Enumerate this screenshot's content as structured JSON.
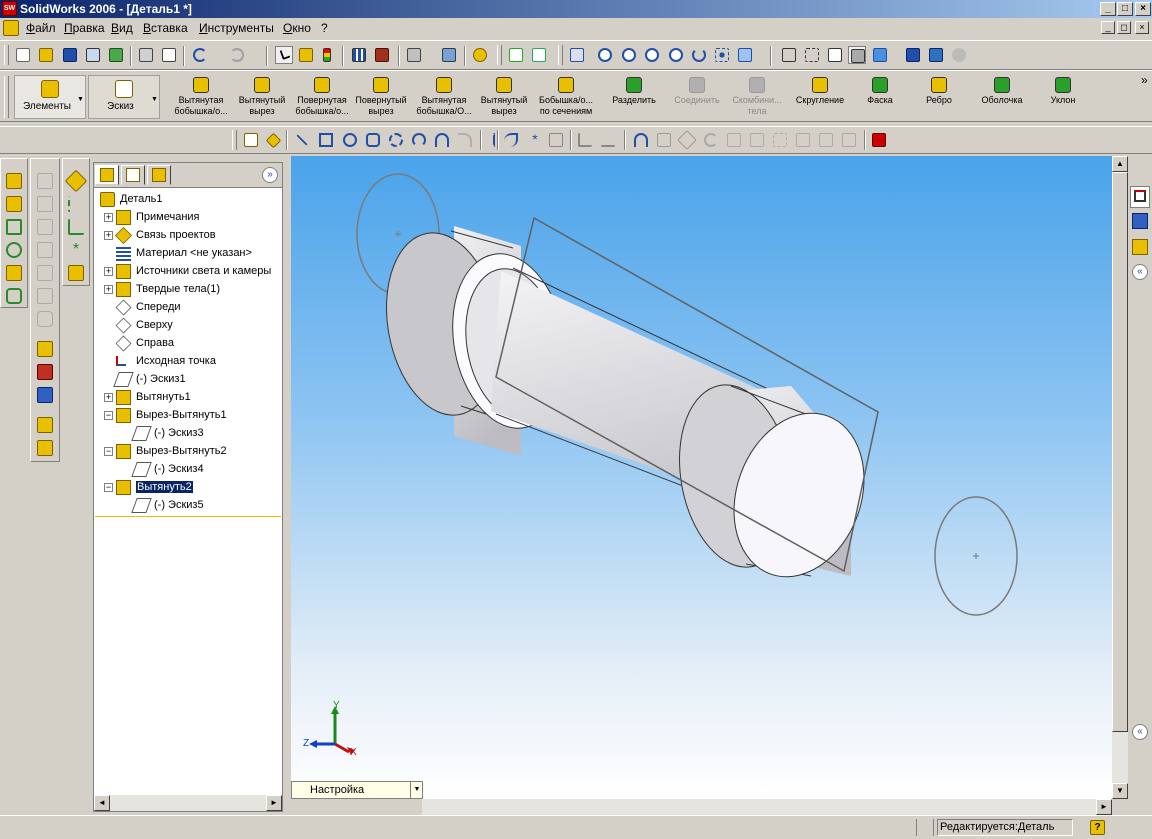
{
  "window": {
    "title": "SolidWorks 2006 - [Деталь1 *]",
    "app_icon": "SW",
    "minimize_label": "_",
    "maximize_label": "□",
    "close_label": "×"
  },
  "menu": {
    "items": [
      "Файл",
      "Правка",
      "Вид",
      "Вставка",
      "Инструменты",
      "Окно",
      "?"
    ],
    "mdi": [
      "_",
      "◻",
      "×"
    ]
  },
  "command_manager": {
    "tabs": [
      {
        "label": "Элементы",
        "icon": "features-icon"
      },
      {
        "label": "Эскиз",
        "icon": "sketch-icon"
      }
    ],
    "dropdown_arrow": "▼",
    "features": [
      {
        "label1": "Вытянутая",
        "label2": "бобышка/о...",
        "icon": "extruded-boss-icon",
        "color": "#e8c000",
        "enabled": true
      },
      {
        "label1": "Вытянутый",
        "label2": "вырез",
        "icon": "extruded-cut-icon",
        "color": "#e8c000",
        "enabled": true
      },
      {
        "label1": "Повернутая",
        "label2": "бобышка/о...",
        "icon": "revolved-boss-icon",
        "color": "#e8c000",
        "enabled": true
      },
      {
        "label1": "Повернутый",
        "label2": "вырез",
        "icon": "revolved-cut-icon",
        "color": "#e8c000",
        "enabled": true
      },
      {
        "label1": "Вытянутая",
        "label2": "бобышка/О...",
        "icon": "swept-boss-icon",
        "color": "#e8c000",
        "enabled": true
      },
      {
        "label1": "Вытянутый",
        "label2": "вырез",
        "icon": "swept-cut-icon",
        "color": "#e8c000",
        "enabled": true
      },
      {
        "label1": "Бобышка/о...",
        "label2": "по сечениям",
        "icon": "loft-icon",
        "color": "#e8c000",
        "enabled": true
      },
      {
        "label1": "Разделить",
        "label2": "",
        "icon": "split-icon",
        "color": "#2aa02a",
        "enabled": true
      },
      {
        "label1": "Соединить",
        "label2": "",
        "icon": "combine-icon",
        "color": "#b0b0b0",
        "enabled": false
      },
      {
        "label1": "Скомбини...",
        "label2": "тела",
        "icon": "combine-bodies-icon",
        "color": "#b0b0b0",
        "enabled": false
      },
      {
        "label1": "Скругление",
        "label2": "",
        "icon": "fillet-icon",
        "color": "#e8c000",
        "enabled": true
      },
      {
        "label1": "Фаска",
        "label2": "",
        "icon": "chamfer-icon",
        "color": "#2aa02a",
        "enabled": true
      },
      {
        "label1": "Ребро",
        "label2": "",
        "icon": "rib-icon",
        "color": "#e8c000",
        "enabled": true
      },
      {
        "label1": "Оболочка",
        "label2": "",
        "icon": "shell-icon",
        "color": "#2aa02a",
        "enabled": true
      },
      {
        "label1": "Уклон",
        "label2": "",
        "icon": "draft-icon",
        "color": "#2aa02a",
        "enabled": true
      }
    ],
    "overflow": "»"
  },
  "tree": {
    "tabs": [
      "feature-manager-icon",
      "property-manager-icon",
      "configuration-manager-icon"
    ],
    "collapse": "»",
    "items": [
      {
        "label": "Деталь1",
        "icon": "part-icon",
        "expander": "",
        "level": 0
      },
      {
        "label": "Примечания",
        "icon": "annotations-icon",
        "expander": "+",
        "level": 1
      },
      {
        "label": "Связь проектов",
        "icon": "design-binder-icon",
        "expander": "+",
        "level": 1
      },
      {
        "label": "Материал <не указан>",
        "icon": "material-icon",
        "expander": "",
        "level": 1
      },
      {
        "label": "Источники света и камеры",
        "icon": "lights-icon",
        "expander": "+",
        "level": 1
      },
      {
        "label": "Твердые тела(1)",
        "icon": "solid-bodies-icon",
        "expander": "+",
        "level": 1
      },
      {
        "label": "Спереди",
        "icon": "plane-icon",
        "expander": "",
        "level": 1
      },
      {
        "label": "Сверху",
        "icon": "plane-icon",
        "expander": "",
        "level": 1
      },
      {
        "label": "Справа",
        "icon": "plane-icon",
        "expander": "",
        "level": 1
      },
      {
        "label": "Исходная точка",
        "icon": "origin-icon",
        "expander": "",
        "level": 1
      },
      {
        "label": "(-) Эскиз1",
        "icon": "sketch-icon",
        "expander": "",
        "level": 1
      },
      {
        "label": "Вытянуть1",
        "icon": "extrude-icon",
        "expander": "+",
        "level": 1
      },
      {
        "label": "Вырез-Вытянуть1",
        "icon": "cut-extrude-icon",
        "expander": "−",
        "level": 1
      },
      {
        "label": "(-) Эскиз3",
        "icon": "sketch-icon",
        "expander": "",
        "level": 2
      },
      {
        "label": "Вырез-Вытянуть2",
        "icon": "cut-extrude-icon",
        "expander": "−",
        "level": 1
      },
      {
        "label": "(-) Эскиз4",
        "icon": "sketch-icon",
        "expander": "",
        "level": 2
      },
      {
        "label": "Вытянуть2",
        "icon": "extrude-icon",
        "expander": "−",
        "level": 1,
        "selected": true
      },
      {
        "label": "(-) Эскиз5",
        "icon": "sketch-icon",
        "expander": "",
        "level": 2
      }
    ]
  },
  "viewport": {
    "triad": {
      "x": "X",
      "y": "Y",
      "z": "Z"
    },
    "settings_label": "Настройка",
    "settings_arrow": "▼"
  },
  "scroll": {
    "up": "▲",
    "down": "▼",
    "left": "◄",
    "right": "►"
  },
  "status": {
    "editing": "Редактируется:Деталь",
    "help_icon": "?"
  },
  "colors": {
    "title_start": "#0a246a",
    "title_end": "#a6caf0",
    "selection": "#0a246a",
    "viewport_top": "#4aa3ea",
    "viewport_bottom": "#ffffff"
  }
}
